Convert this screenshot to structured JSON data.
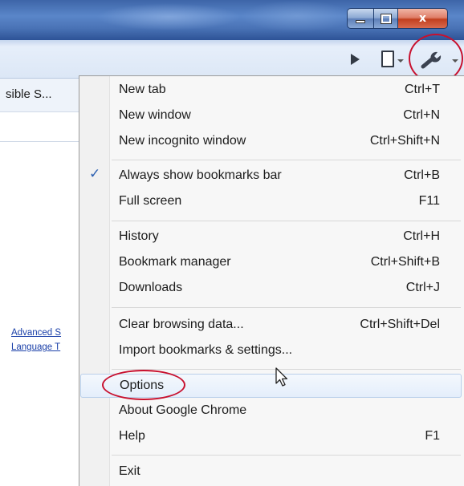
{
  "window": {
    "controls": {
      "minimize_icon": "minimize-icon",
      "maximize_icon": "restore-icon",
      "close_label": "x"
    }
  },
  "toolbar": {
    "icons": [
      "play-icon",
      "page-icon",
      "wrench-icon"
    ]
  },
  "page": {
    "tab_label": "sible S...",
    "links": [
      "Advanced S",
      "Language T"
    ]
  },
  "menu": {
    "groups": [
      {
        "items": [
          {
            "label": "New tab",
            "shortcut": "Ctrl+T"
          },
          {
            "label": "New window",
            "shortcut": "Ctrl+N"
          },
          {
            "label": "New incognito window",
            "shortcut": "Ctrl+Shift+N"
          }
        ]
      },
      {
        "items": [
          {
            "label": "Always show bookmarks bar",
            "shortcut": "Ctrl+B",
            "checked": true
          },
          {
            "label": "Full screen",
            "shortcut": "F11"
          }
        ]
      },
      {
        "items": [
          {
            "label": "History",
            "shortcut": "Ctrl+H"
          },
          {
            "label": "Bookmark manager",
            "shortcut": "Ctrl+Shift+B"
          },
          {
            "label": "Downloads",
            "shortcut": "Ctrl+J"
          }
        ]
      },
      {
        "items": [
          {
            "label": "Clear browsing data...",
            "shortcut": "Ctrl+Shift+Del"
          },
          {
            "label": "Import bookmarks & settings...",
            "shortcut": ""
          }
        ]
      },
      {
        "items": [
          {
            "label": "Options",
            "shortcut": "",
            "highlighted": true
          },
          {
            "label": "About Google Chrome",
            "shortcut": ""
          },
          {
            "label": "Help",
            "shortcut": "F1"
          }
        ]
      },
      {
        "items": [
          {
            "label": "Exit",
            "shortcut": ""
          }
        ]
      }
    ],
    "check_glyph": "✓"
  },
  "colors": {
    "annotation_circle": "#c8102e",
    "check": "#2a5fb0",
    "link": "#1a3fa8"
  }
}
